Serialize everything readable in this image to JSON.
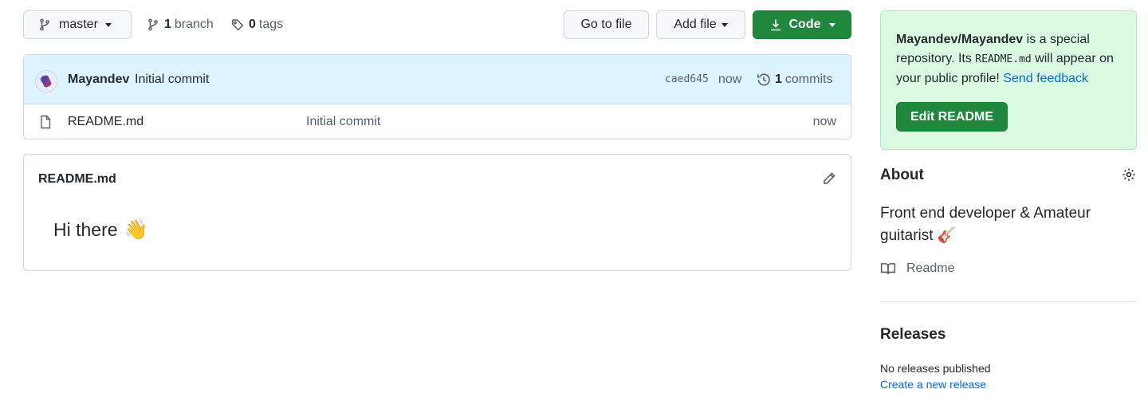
{
  "toolbar": {
    "branch_label": "master",
    "branch_count": "1",
    "branch_word": "branch",
    "tag_count": "0",
    "tag_word": "tags",
    "go_to_file": "Go to file",
    "add_file": "Add file",
    "code": "Code"
  },
  "latest_commit": {
    "author": "Mayandev",
    "message": "Initial commit",
    "sha": "caed645",
    "time": "now",
    "count": "1",
    "count_word": "commits"
  },
  "files": [
    {
      "name": "README.md",
      "message": "Initial commit",
      "time": "now"
    }
  ],
  "readme": {
    "title": "README.md",
    "greeting": "Hi there",
    "greeting_emoji": "👋"
  },
  "sidebar": {
    "special": {
      "repo": "Mayandev/Mayandev",
      "text_1": " is a special repository. Its ",
      "file": "README.md",
      "text_2": " will appear on your public profile! ",
      "feedback": "Send feedback",
      "edit_button": "Edit README"
    },
    "about": {
      "heading": "About",
      "description": "Front end developer & Amateur guitarist",
      "emoji": "🎸",
      "readme_link": "Readme"
    },
    "releases": {
      "heading": "Releases",
      "none": "No releases published",
      "create": "Create a new release"
    }
  },
  "colors": {
    "primary_green": "#1f883d",
    "link_blue": "#0969da",
    "commit_bg": "#ddf4ff",
    "special_bg": "#dafbe1"
  },
  "icons": {
    "branch": "git-branch-icon",
    "tag": "tag-icon",
    "download": "download-icon",
    "history": "history-icon",
    "file": "file-icon",
    "pencil": "pencil-icon",
    "gear": "gear-icon",
    "book": "book-icon"
  }
}
